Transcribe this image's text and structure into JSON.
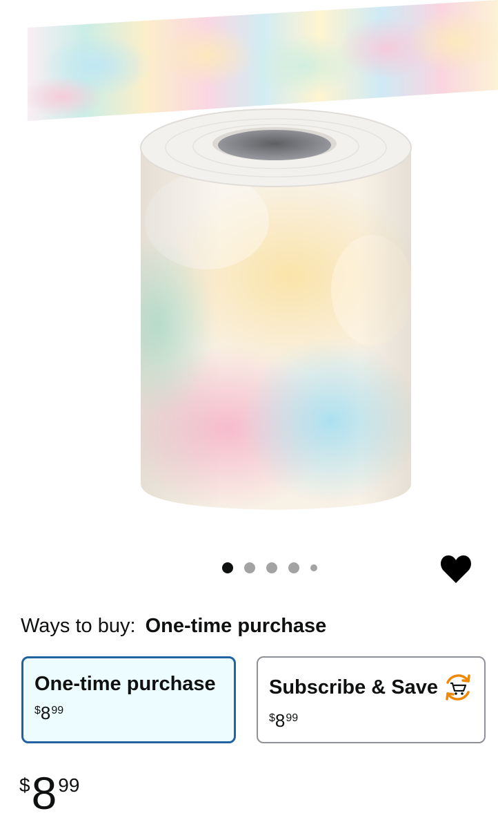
{
  "product_image": {
    "alt": "tie-dye border roll product image"
  },
  "carousel": {
    "dots": [
      {
        "state": "active"
      },
      {
        "state": "inactive"
      },
      {
        "state": "inactive"
      },
      {
        "state": "inactive"
      },
      {
        "state": "inactive-small"
      }
    ]
  },
  "wishlist": {
    "icon": "heart-icon"
  },
  "ways_to_buy": {
    "label": "Ways to buy:",
    "value": "One-time purchase"
  },
  "options": [
    {
      "title": "One-time purchase",
      "price_symbol": "$",
      "price_whole": "8",
      "price_fraction": "99",
      "selected": true
    },
    {
      "title": "Subscribe & Save",
      "price_symbol": "$",
      "price_whole": "8",
      "price_fraction": "99",
      "selected": false,
      "icon": "subscribe-save-cart-icon"
    }
  ],
  "price": {
    "symbol": "$",
    "whole": "8",
    "fraction": "99"
  },
  "colors": {
    "selected_border": "#2162a1",
    "selected_bg": "#edfdff",
    "sns_orange": "#f08804"
  }
}
